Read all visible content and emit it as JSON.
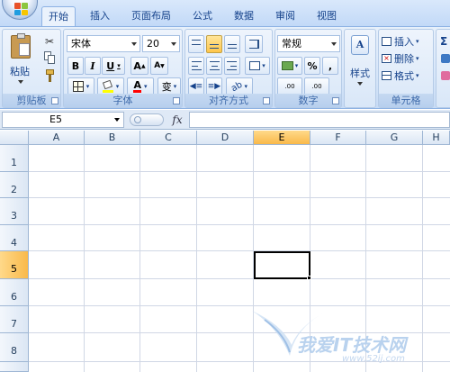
{
  "tabs": [
    {
      "label": "开始",
      "active": true
    },
    {
      "label": "插入"
    },
    {
      "label": "页面布局"
    },
    {
      "label": "公式"
    },
    {
      "label": "数据"
    },
    {
      "label": "审阅"
    },
    {
      "label": "视图"
    }
  ],
  "clipboard": {
    "paste_label": "粘贴",
    "group_label": "剪贴板"
  },
  "font": {
    "name": "宋体",
    "size": "20",
    "bold": "B",
    "italic": "I",
    "underline": "U",
    "grow": "A",
    "shrink": "A",
    "color_glyph": "A",
    "phonetic": "变",
    "group_label": "字体"
  },
  "alignment": {
    "group_label": "对齐方式"
  },
  "number": {
    "format": "常规",
    "percent": "%",
    "comma": ",",
    "inc_decimal": ".00",
    "dec_decimal": ".00",
    "group_label": "数字"
  },
  "styles": {
    "label": "样式"
  },
  "cells": {
    "insert": "插入",
    "delete": "删除",
    "format": "格式",
    "group_label": "单元格"
  },
  "editing": {
    "sigma": "Σ"
  },
  "formula_bar": {
    "name_box": "E5",
    "fx": "fx",
    "formula": ""
  },
  "sheet": {
    "columns": [
      "A",
      "B",
      "C",
      "D",
      "E",
      "F",
      "G",
      "H"
    ],
    "rows": [
      "1",
      "2",
      "3",
      "4",
      "5",
      "6",
      "7",
      "8"
    ],
    "active_cell": "E5"
  },
  "watermark": {
    "text": "我爱IT技术网",
    "url": "www.52ij.com"
  },
  "colors": {
    "ribbon": "#dbe7f8",
    "selection_header": "#f9c65a",
    "font_color": "#ff0000",
    "fill_color": "#ffff00"
  }
}
